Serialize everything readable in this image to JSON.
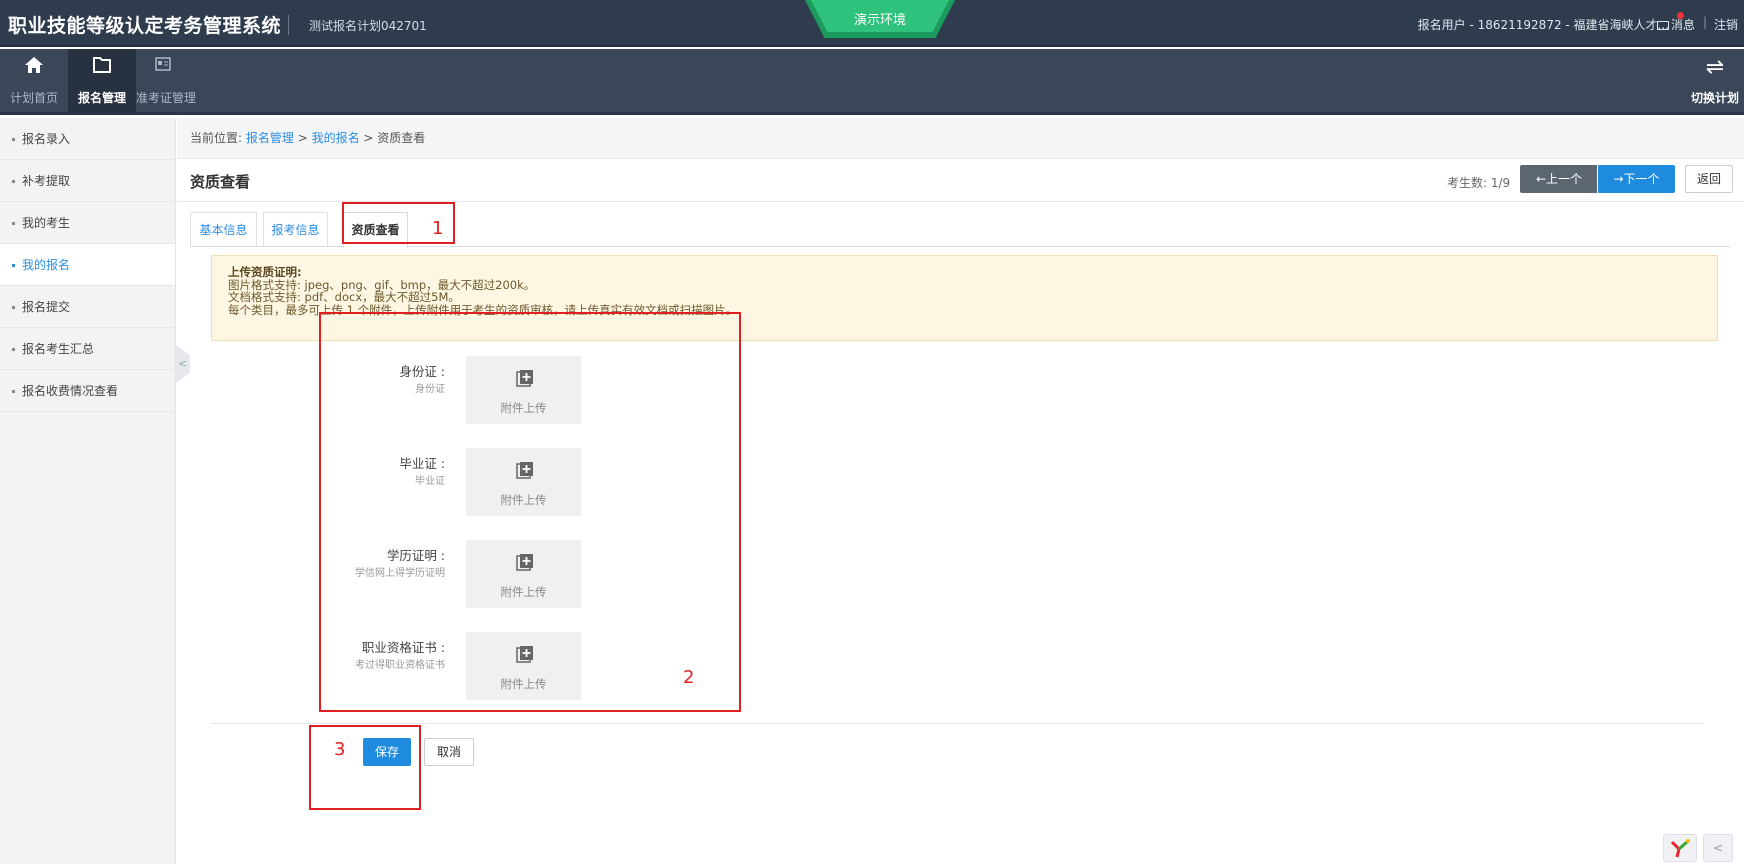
{
  "header": {
    "app_title": "职业技能等级认定考务管理系统",
    "plan_name": "测试报名计划042701",
    "env_badge": "演示环境",
    "user_info": "报名用户 - 18621192872 - 福建省海峡人才...",
    "messages": "消息",
    "separator": "|",
    "logout": "注销"
  },
  "nav": {
    "items": [
      {
        "label": "计划首页",
        "icon": "home-icon"
      },
      {
        "label": "报名管理",
        "icon": "folder-icon",
        "active": true
      },
      {
        "label": "准考证管理",
        "icon": "id-card-icon"
      }
    ],
    "switch_plan": "切换计划",
    "switch_icon": "⇌"
  },
  "sidebar": {
    "items": [
      {
        "label": "报名录入"
      },
      {
        "label": "补考提取"
      },
      {
        "label": "我的考生"
      },
      {
        "label": "我的报名",
        "active": true
      },
      {
        "label": "报名提交"
      },
      {
        "label": "报名考生汇总"
      },
      {
        "label": "报名收费情况查看"
      }
    ],
    "collapse_glyph": "<"
  },
  "breadcrumb": {
    "prefix": "当前位置: ",
    "level1": "报名管理",
    "sep": " > ",
    "level2": "我的报名",
    "current": "资质查看"
  },
  "page": {
    "title": "资质查看",
    "count_label": "考生数: 1/9",
    "prev": "←上一个",
    "next": "→下一个",
    "back": "返回"
  },
  "tabs": [
    {
      "label": "基本信息"
    },
    {
      "label": "报考信息"
    },
    {
      "label": "资质查看",
      "active": true
    }
  ],
  "tip": {
    "title": "上传资质证明:",
    "line1": "图片格式支持: jpeg、png、gif、bmp，最大不超过200k。",
    "line2": "文档格式支持: pdf、docx，最大不超过5M。",
    "line3": "每个类目，最多可上传 1 个附件，上传附件用于考生的资质审核，请上传真实有效文档或扫描图片。"
  },
  "docs": [
    {
      "label": "身份证 :",
      "hint": "身份证",
      "upload": "附件上传"
    },
    {
      "label": "毕业证 :",
      "hint": "毕业证",
      "upload": "附件上传"
    },
    {
      "label": "学历证明 :",
      "hint": "学信网上得学历证明",
      "upload": "附件上传"
    },
    {
      "label": "职业资格证书 :",
      "hint": "考过得职业资格证书",
      "upload": "附件上传"
    }
  ],
  "actions": {
    "save": "保存",
    "cancel": "取消"
  },
  "annotations": {
    "n1": "1",
    "n2": "2",
    "n3": "3",
    "color": "#e02020"
  },
  "colors": {
    "topbar": "#2f3c4e",
    "accent": "#1f8bde",
    "env_badge": "#2fc27c",
    "tip_bg": "#fdf6e3"
  },
  "corner": {
    "arrow": "<"
  }
}
